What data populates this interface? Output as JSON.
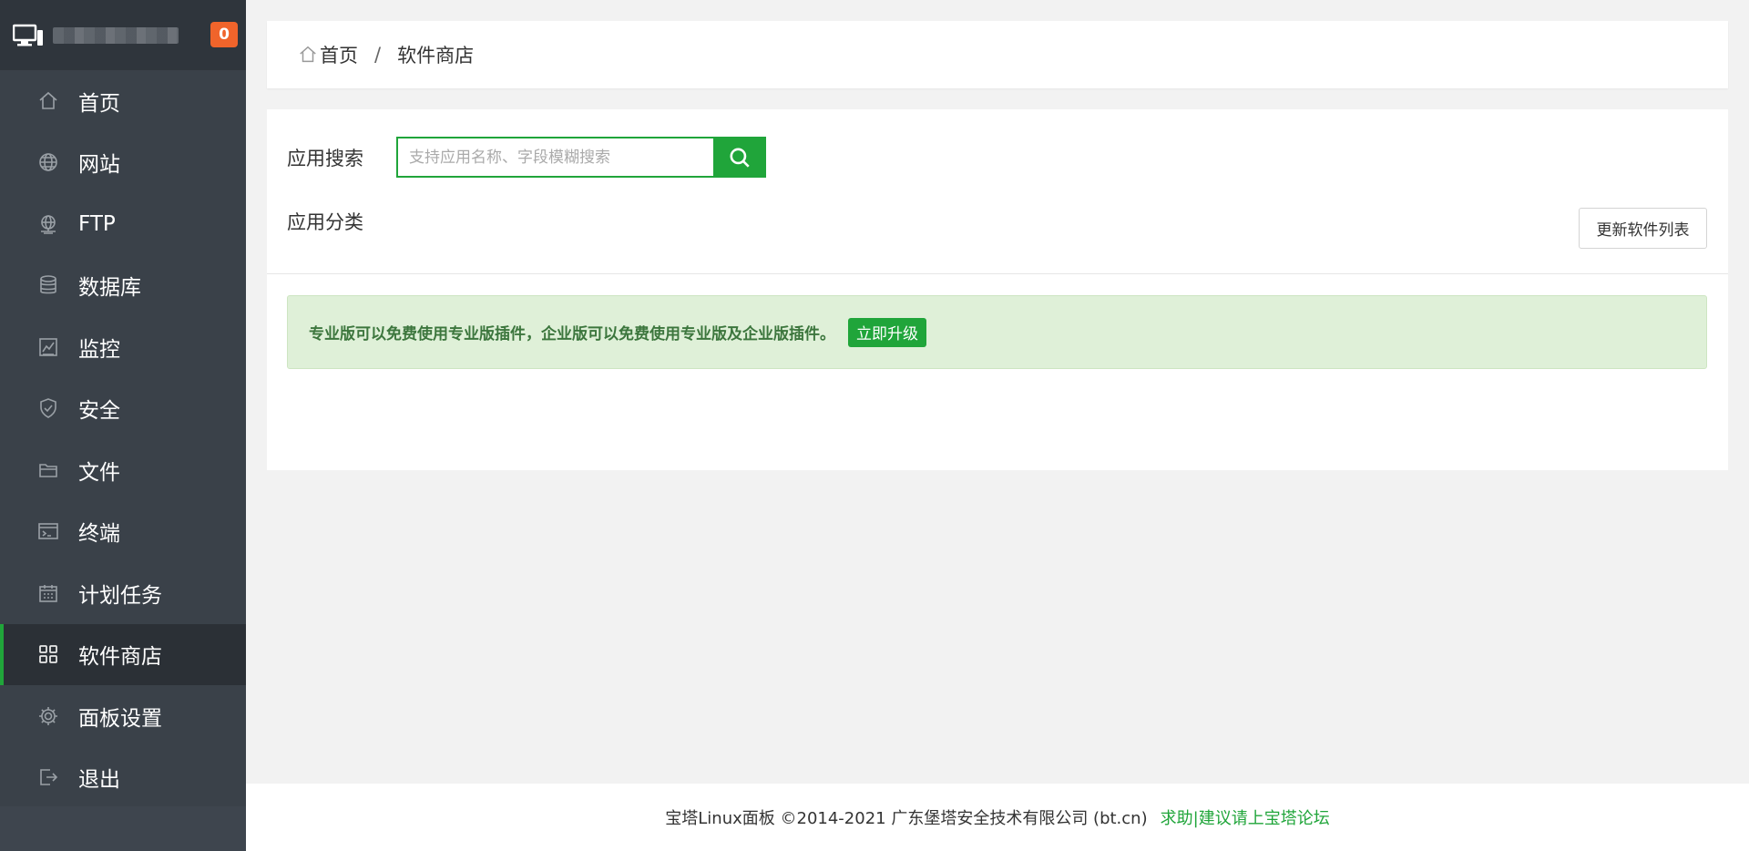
{
  "sidebar": {
    "notification_count": "0",
    "items": [
      {
        "label": "首页",
        "icon": "home-icon"
      },
      {
        "label": "网站",
        "icon": "globe-icon"
      },
      {
        "label": "FTP",
        "icon": "ftp-icon"
      },
      {
        "label": "数据库",
        "icon": "database-icon"
      },
      {
        "label": "监控",
        "icon": "monitor-icon"
      },
      {
        "label": "安全",
        "icon": "shield-icon"
      },
      {
        "label": "文件",
        "icon": "folder-icon"
      },
      {
        "label": "终端",
        "icon": "terminal-icon"
      },
      {
        "label": "计划任务",
        "icon": "calendar-icon"
      },
      {
        "label": "软件商店",
        "icon": "grid-icon"
      },
      {
        "label": "面板设置",
        "icon": "gear-icon"
      },
      {
        "label": "退出",
        "icon": "logout-icon"
      }
    ],
    "active_item": "软件商店"
  },
  "breadcrumb": {
    "home": "首页",
    "separator": "/",
    "current": "软件商店"
  },
  "main": {
    "search_label": "应用搜索",
    "search_placeholder": "支持应用名称、字段模糊搜索",
    "search_value": "",
    "category_label": "应用分类",
    "refresh_button": "更新软件列表",
    "alert_text": "专业版可以免费使用专业版插件，企业版可以免费使用专业版及企业版插件。",
    "upgrade_button": "立即升级"
  },
  "footer": {
    "copyright": "宝塔Linux面板 ©2014-2021 广东堡塔安全技术有限公司 (bt.cn)",
    "forum_link": "求助|建议请上宝塔论坛"
  },
  "colors": {
    "sidebar_bg": "#3a4149",
    "accent_green": "#20a53a",
    "badge_orange": "#f0642b",
    "alert_bg": "#dff0d8",
    "alert_text": "#3c763d"
  }
}
